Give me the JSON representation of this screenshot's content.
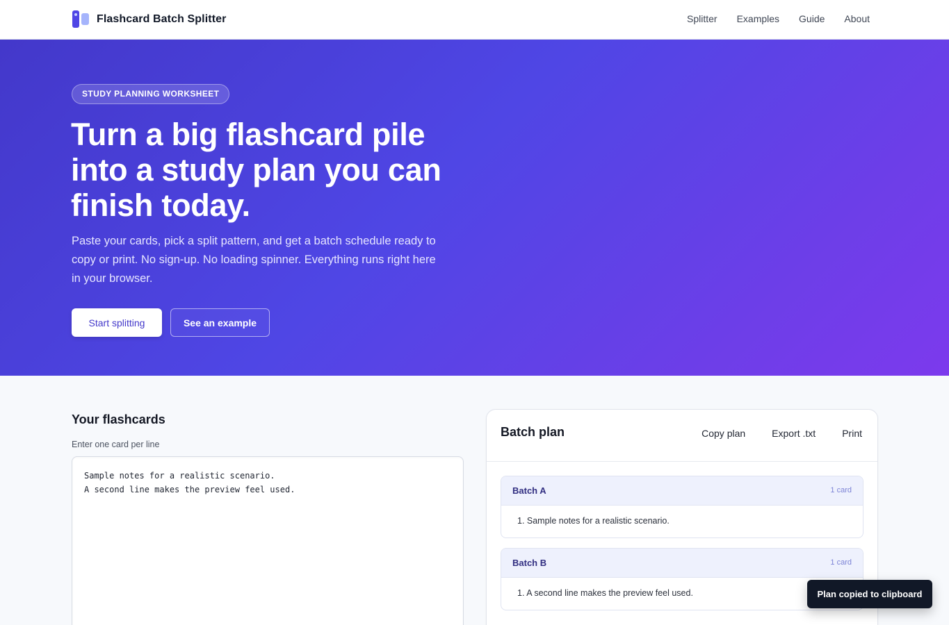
{
  "app": {
    "name": "Flashcard Batch Splitter"
  },
  "nav": {
    "items": [
      "Splitter",
      "Examples",
      "Guide",
      "About"
    ]
  },
  "hero": {
    "badge": "STUDY PLANNING WORKSHEET",
    "title": "Turn a big flashcard pile into a study plan you can finish today.",
    "subtitle": "Paste your cards, pick a split pattern, and get a batch schedule ready to copy or print. No sign-up. No loading spinner. Everything runs right here in your browser.",
    "primary_button": "Start splitting",
    "secondary_button": "See an example"
  },
  "editor": {
    "title": "Your flashcards",
    "label": "Enter one card per line",
    "value": "Sample notes for a realistic scenario.\nA second line makes the preview feel used."
  },
  "plan": {
    "title": "Batch plan",
    "actions": [
      "Copy plan",
      "Export .txt",
      "Print"
    ],
    "batches": [
      {
        "name": "Batch A",
        "count": "1 card",
        "items": [
          "1. Sample notes for a realistic scenario."
        ]
      },
      {
        "name": "Batch B",
        "count": "1 card",
        "items": [
          "1. A second line makes the preview feel used."
        ]
      }
    ]
  },
  "toast": {
    "message": "Plan copied to clipboard"
  },
  "colors": {
    "accent": "#4f46e5",
    "hero_start": "#4338ca",
    "hero_end": "#7c3aed",
    "toast_bg": "#111827"
  }
}
